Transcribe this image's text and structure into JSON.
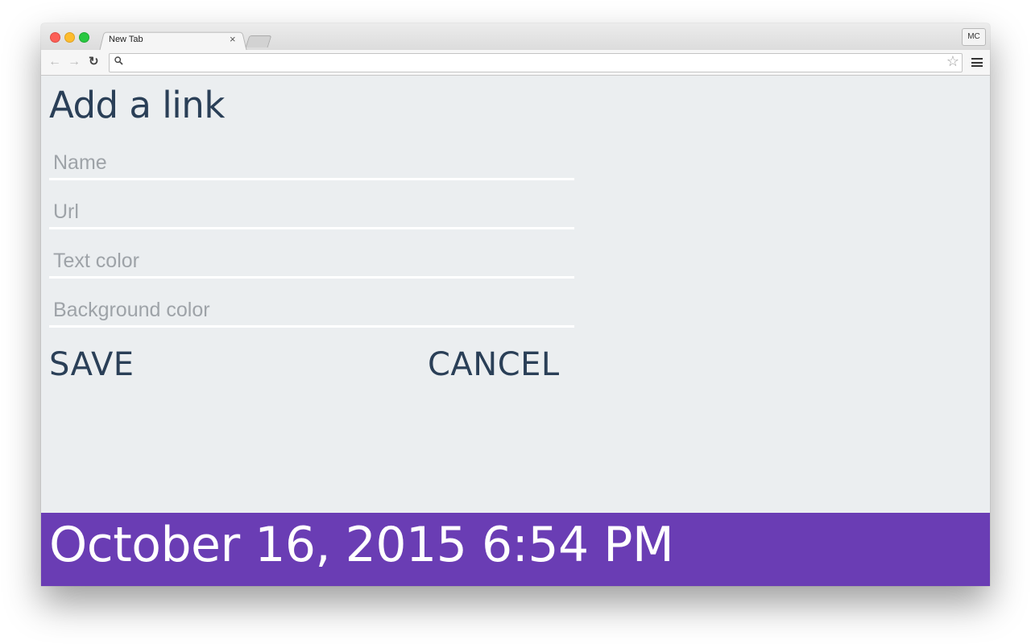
{
  "browser": {
    "tab_title": "New Tab",
    "tab_close": "×",
    "profile_label": "MC",
    "address_value": "",
    "icons": {
      "back": "arrow-left-icon",
      "forward": "arrow-right-icon",
      "reload": "reload-icon",
      "search": "search-icon",
      "bookmark": "star-icon",
      "menu": "hamburger-menu-icon"
    }
  },
  "form": {
    "title": "Add a link",
    "fields": [
      {
        "placeholder": "Name",
        "value": ""
      },
      {
        "placeholder": "Url",
        "value": ""
      },
      {
        "placeholder": "Text color",
        "value": ""
      },
      {
        "placeholder": "Background color",
        "value": ""
      }
    ],
    "save_label": "SAVE",
    "cancel_label": "CANCEL"
  },
  "footer": {
    "datetime": "October 16, 2015 6:54 PM"
  },
  "colors": {
    "page_background": "#ebeef0",
    "text_primary": "#2a3f57",
    "footer_background": "#6a3db4",
    "footer_text": "#ffffff"
  }
}
